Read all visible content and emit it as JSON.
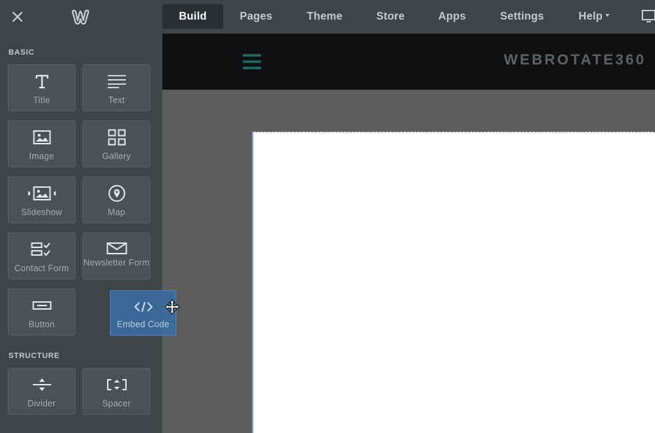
{
  "topbar": {
    "tabs": [
      {
        "label": "Build",
        "active": true
      },
      {
        "label": "Pages"
      },
      {
        "label": "Theme"
      },
      {
        "label": "Store"
      },
      {
        "label": "Apps"
      },
      {
        "label": "Settings"
      },
      {
        "label": "Help"
      }
    ],
    "icons": {
      "close": "close-icon",
      "logo": "weebly-logo",
      "device": "desktop-icon"
    }
  },
  "sidebar": {
    "basic_title": "BASIC",
    "structure_title": "STRUCTURE",
    "basic_items": [
      {
        "label": "Title",
        "icon": "title-icon"
      },
      {
        "label": "Text",
        "icon": "text-icon"
      },
      {
        "label": "Image",
        "icon": "image-icon"
      },
      {
        "label": "Gallery",
        "icon": "gallery-icon"
      },
      {
        "label": "Slideshow",
        "icon": "slideshow-icon"
      },
      {
        "label": "Map",
        "icon": "map-pin-icon"
      },
      {
        "label": "Contact Form",
        "icon": "contact-form-icon"
      },
      {
        "label": "Newsletter Form",
        "icon": "envelope-icon"
      },
      {
        "label": "Button",
        "icon": "button-icon"
      }
    ],
    "structure_items": [
      {
        "label": "Divider",
        "icon": "divider-icon"
      },
      {
        "label": "Spacer",
        "icon": "spacer-icon"
      }
    ]
  },
  "drag": {
    "label": "Embed Code",
    "icon": "code-icon",
    "cursor": "move-cursor-icon"
  },
  "site": {
    "title": "WEBROTATE360",
    "menu_icon": "hamburger-menu-icon"
  },
  "colors": {
    "toolbar_bg": "#3f4446",
    "tile_bg": "#4c5254",
    "active_tab_bg": "#2b2f31",
    "drag_blue": "#386ea5",
    "site_header": "#0f1011",
    "hamburger_teal": "#1f6b64",
    "canvas_gray": "#5c5c5c"
  }
}
